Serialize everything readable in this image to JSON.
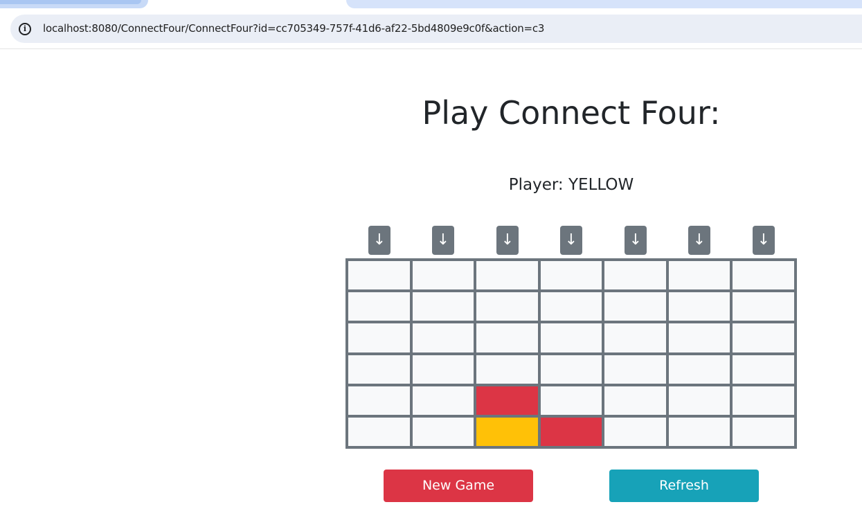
{
  "browser": {
    "url": "localhost:8080/ConnectFour/ConnectFour?id=cc705349-757f-41d6-af22-5bd4809e9c0f&action=c3",
    "info_icon": "info-icon",
    "info_glyph": "i"
  },
  "page": {
    "title": "Play Connect Four:",
    "player_text": "Player: YELLOW"
  },
  "drop_buttons": {
    "glyph": "↓",
    "columns": [
      1,
      2,
      3,
      4,
      5,
      6,
      7
    ]
  },
  "board": {
    "rows": 6,
    "cols": 7,
    "cells": [
      [
        "empty",
        "empty",
        "empty",
        "empty",
        "empty",
        "empty",
        "empty"
      ],
      [
        "empty",
        "empty",
        "empty",
        "empty",
        "empty",
        "empty",
        "empty"
      ],
      [
        "empty",
        "empty",
        "empty",
        "empty",
        "empty",
        "empty",
        "empty"
      ],
      [
        "empty",
        "empty",
        "empty",
        "empty",
        "empty",
        "empty",
        "empty"
      ],
      [
        "empty",
        "empty",
        "red",
        "empty",
        "empty",
        "empty",
        "empty"
      ],
      [
        "empty",
        "empty",
        "yellow",
        "red",
        "empty",
        "empty",
        "empty"
      ]
    ]
  },
  "buttons": {
    "new_game": "New Game",
    "refresh": "Refresh"
  },
  "colors": {
    "red": "#dc3545",
    "yellow": "#ffc107",
    "empty": "#f8f9fa",
    "frame": "#6c757d",
    "refresh": "#17a2b8"
  }
}
